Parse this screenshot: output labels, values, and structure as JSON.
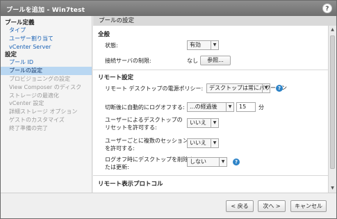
{
  "window": {
    "title": "プールを追加 - Win7test",
    "help": "?"
  },
  "sidebar": {
    "section1": "プール定義",
    "items1": [
      "タイプ",
      "ユーザー割り当て",
      "vCenter Server"
    ],
    "section2": "設定",
    "items2": [
      "プール ID",
      "プールの設定",
      "プロビジョニングの設定",
      "View Composer のディスク",
      "ストレージの最適化",
      "vCenter 設定",
      "詳細ストレージ オプション",
      "ゲストのカスタマイズ",
      "終了準備の完了"
    ]
  },
  "main": {
    "header": "プールの設定",
    "general": {
      "title": "全般",
      "state_label": "状態:",
      "state_value": "有効",
      "access_label": "接続サーバの制限:",
      "access_value": "なし",
      "browse": "参照..."
    },
    "remote": {
      "title": "リモート設定",
      "power_label": "リモート デスクトップの電源ポリシー:",
      "power_value": "デスクトップは常にパワーオン",
      "logoff_label": "切断後に自動的にログオフする:",
      "logoff_value": "...の経過後",
      "logoff_minutes": "15",
      "minutes_unit": "分",
      "reset_label_line1": "ユーザーによるデスクトップの",
      "reset_label_line2": "リセットを許可する:",
      "reset_value": "いいえ",
      "multi_label_line1": "ユーザーごとに複数のセッション",
      "multi_label_line2": "を許可する:",
      "multi_value": "いいえ",
      "delete_label_line1": "ログオフ時にデスクトップを削除ま",
      "delete_label_line2": "たは更新:",
      "delete_value": "しない"
    },
    "display": {
      "title": "リモート表示プロトコル"
    }
  },
  "footer": {
    "back": "< 戻る",
    "next": "次へ >",
    "cancel": "キャンセル"
  }
}
